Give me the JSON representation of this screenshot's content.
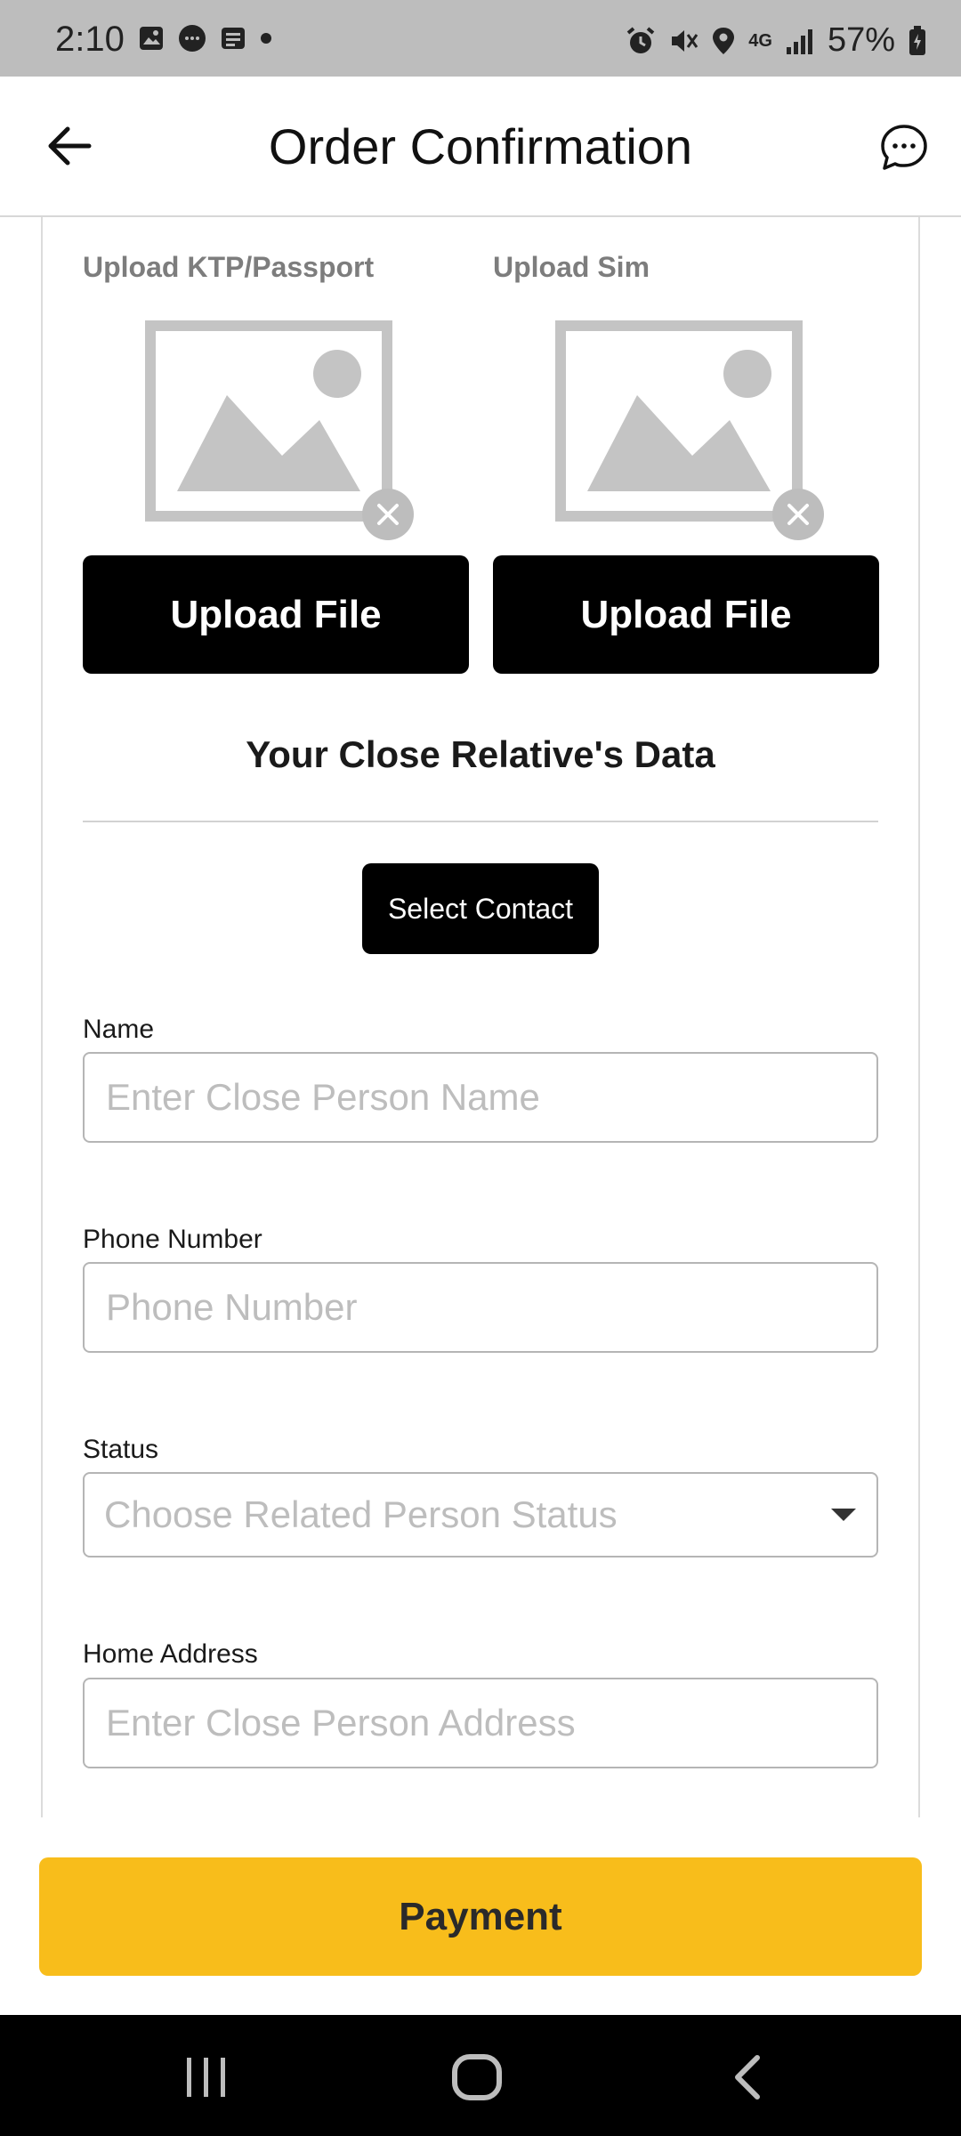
{
  "status_bar": {
    "time": "2:10",
    "battery": "57%",
    "network": "4G"
  },
  "header": {
    "title": "Order Confirmation"
  },
  "uploads": {
    "ktp_label": "Upload KTP/Passport",
    "sim_label": "Upload Sim",
    "ktp_button": "Upload File",
    "sim_button": "Upload File"
  },
  "relative": {
    "section_title": "Your Close Relative's Data",
    "select_contact": "Select Contact",
    "name_label": "Name",
    "name_placeholder": "Enter Close Person Name",
    "phone_label": "Phone Number",
    "phone_placeholder": "Phone Number",
    "status_label": "Status",
    "status_placeholder": "Choose Related Person Status",
    "address_label": "Home Address",
    "address_placeholder": "Enter Close Person Address"
  },
  "footer": {
    "payment_button": "Payment"
  },
  "colors": {
    "accent": "#f8bd1b",
    "button_dark": "#000000",
    "status_bar": "#bdbdbd"
  },
  "icons": [
    "back-arrow-icon",
    "chat-bubble-icon",
    "image-placeholder-icon",
    "close-icon",
    "dropdown-caret-icon",
    "recents-icon",
    "home-icon",
    "nav-back-icon"
  ]
}
